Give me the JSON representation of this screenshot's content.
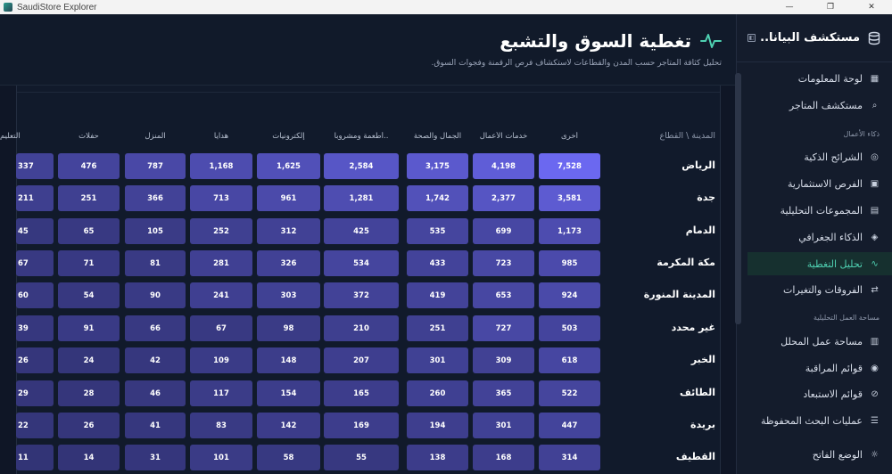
{
  "window": {
    "title": "SaudiStore Explorer",
    "minimize": "—",
    "maximize": "❐",
    "close": "✕"
  },
  "sidebar": {
    "brand": "مستكشف البيانا..",
    "sections": [
      {
        "title": "",
        "items": [
          {
            "label": "لوحة المعلومات",
            "icon": "grid-icon"
          },
          {
            "label": "مستكشف المتاجر",
            "icon": "search-icon"
          }
        ]
      },
      {
        "title": "ذكاء الأعمال",
        "items": [
          {
            "label": "الشرائح الذكية",
            "icon": "target-icon"
          },
          {
            "label": "الفرص الاستثمارية",
            "icon": "briefcase-icon"
          },
          {
            "label": "المجموعات التحليلية",
            "icon": "layers-icon"
          },
          {
            "label": "الذكاء الجغرافي",
            "icon": "compass-icon"
          },
          {
            "label": "تحليل التغطية",
            "icon": "pulse-icon",
            "active": true
          },
          {
            "label": "الفروقات والتغيرات",
            "icon": "swap-icon"
          }
        ]
      },
      {
        "title": "مساحة العمل التحليلية",
        "items": [
          {
            "label": "مساحة عمل المحلل",
            "icon": "book-icon"
          },
          {
            "label": "قوائم المراقبة",
            "icon": "eye-icon"
          },
          {
            "label": "قوائم الاستبعاد",
            "icon": "ban-icon"
          },
          {
            "label": "عمليات البحث المحفوظة",
            "icon": "database-icon"
          }
        ]
      }
    ],
    "theme_toggle": "الوضع الفاتح"
  },
  "header": {
    "title": "تغطية السوق والتشبع",
    "subtitle": "تحليل كثافة المتاجر حسب المدن والقطاعات لاستكشاف فرص الرقمنة وفجوات السوق."
  },
  "table": {
    "corner_label": "المدينة \\ القطاع",
    "columns": [
      "أخرى",
      "خدمات الأعمال",
      "الجمال والصحة",
      "أطعمة ومشروبا..",
      "إلكترونيات",
      "هدايا",
      "المنزل",
      "حفلات",
      "التعليم"
    ],
    "rows": [
      {
        "city": "الرياض",
        "values": [
          "7,528",
          "4,198",
          "3,175",
          "2,584",
          "1,625",
          "1,168",
          "787",
          "476",
          "337"
        ]
      },
      {
        "city": "جدة",
        "values": [
          "3,581",
          "2,377",
          "1,742",
          "1,281",
          "961",
          "713",
          "366",
          "251",
          "211"
        ]
      },
      {
        "city": "الدمام",
        "values": [
          "1,173",
          "699",
          "535",
          "425",
          "312",
          "252",
          "105",
          "65",
          "45"
        ]
      },
      {
        "city": "مكة المكرمة",
        "values": [
          "985",
          "723",
          "433",
          "534",
          "326",
          "281",
          "81",
          "71",
          "67"
        ]
      },
      {
        "city": "المدينة المنورة",
        "values": [
          "924",
          "653",
          "419",
          "372",
          "303",
          "241",
          "90",
          "54",
          "60"
        ]
      },
      {
        "city": "غير محدد",
        "values": [
          "503",
          "727",
          "251",
          "210",
          "98",
          "67",
          "66",
          "91",
          "39"
        ]
      },
      {
        "city": "الخبر",
        "values": [
          "618",
          "309",
          "301",
          "207",
          "148",
          "109",
          "42",
          "24",
          "26"
        ]
      },
      {
        "city": "الطائف",
        "values": [
          "522",
          "365",
          "260",
          "165",
          "154",
          "117",
          "46",
          "28",
          "29"
        ]
      },
      {
        "city": "بريدة",
        "values": [
          "447",
          "301",
          "194",
          "169",
          "142",
          "83",
          "41",
          "26",
          "22"
        ]
      },
      {
        "city": "القطيف",
        "values": [
          "314",
          "168",
          "138",
          "55",
          "58",
          "101",
          "31",
          "14",
          "11"
        ]
      }
    ]
  },
  "colors": {
    "accent": "#4fd1b2",
    "cell_high": "#6b68f0",
    "cell_low": "#2c2e68"
  }
}
